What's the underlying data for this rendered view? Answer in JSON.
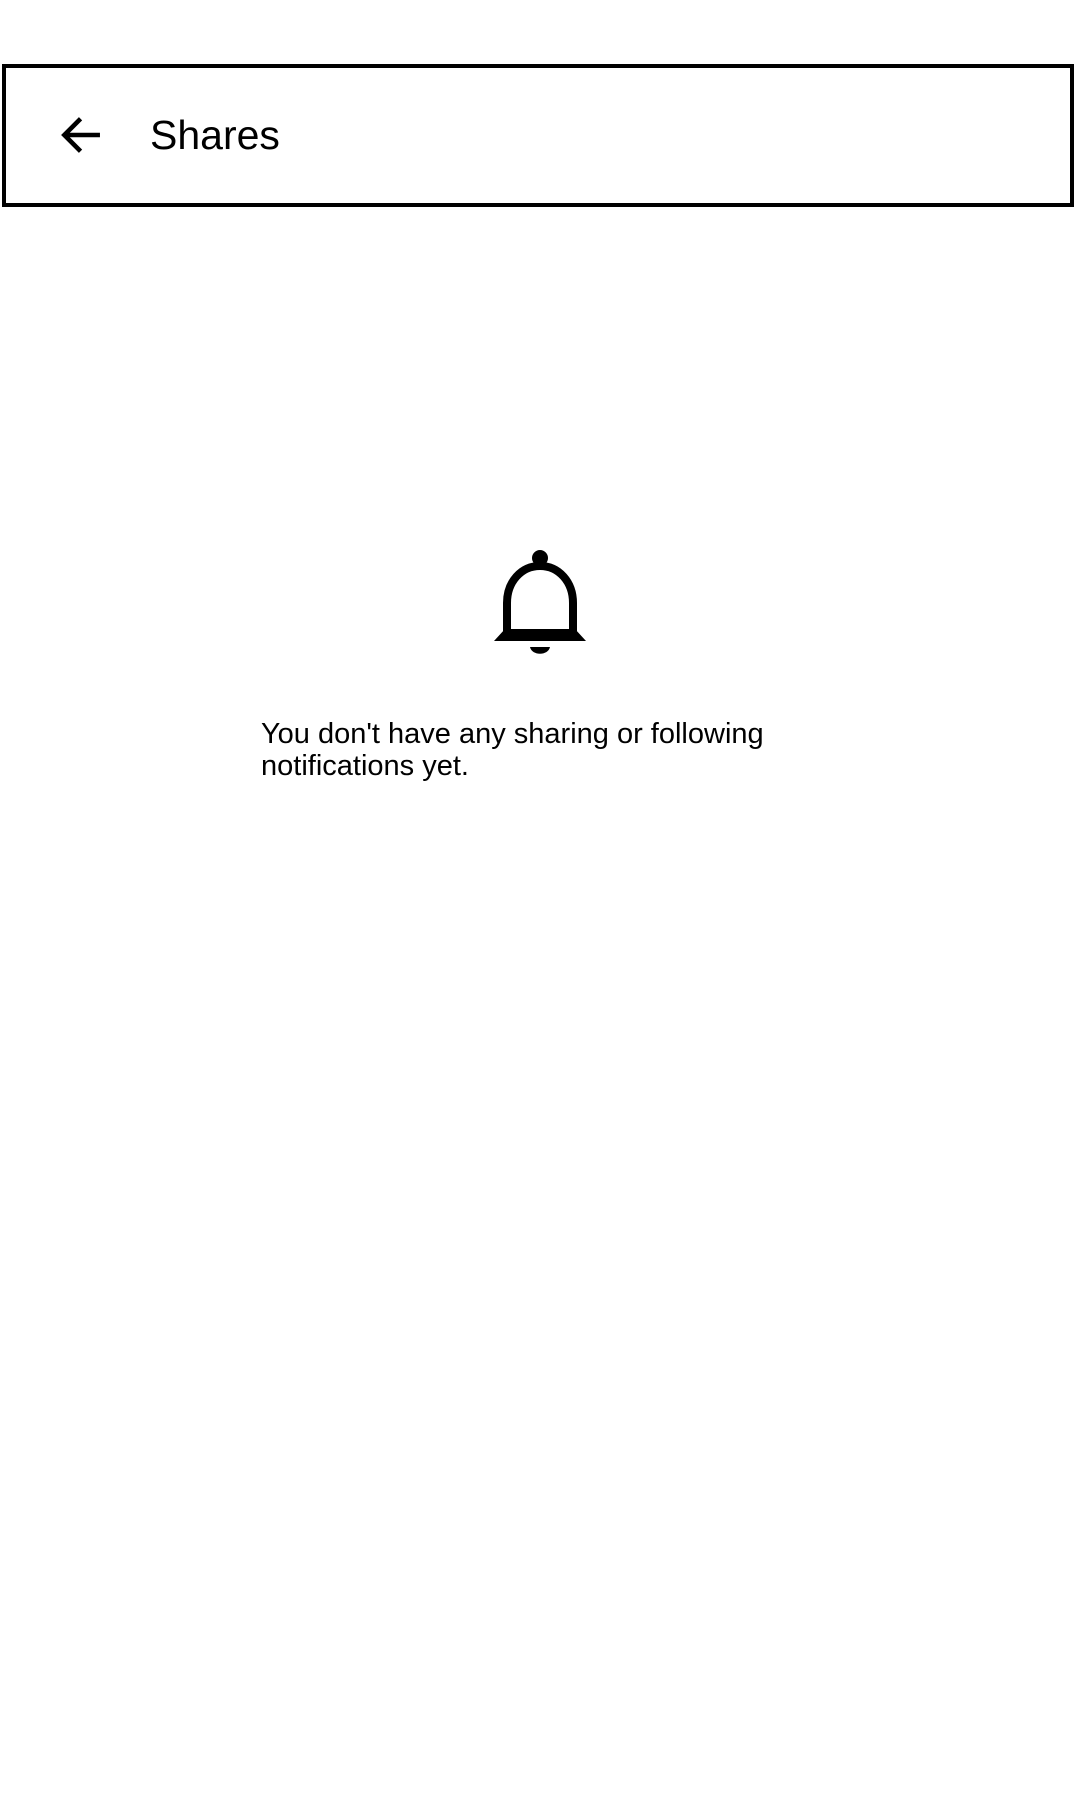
{
  "app_bar": {
    "back_icon": "arrow-back-icon",
    "title": "Shares"
  },
  "empty_state": {
    "icon": "bell-icon",
    "message": "You don't have any sharing or following notifications yet."
  }
}
